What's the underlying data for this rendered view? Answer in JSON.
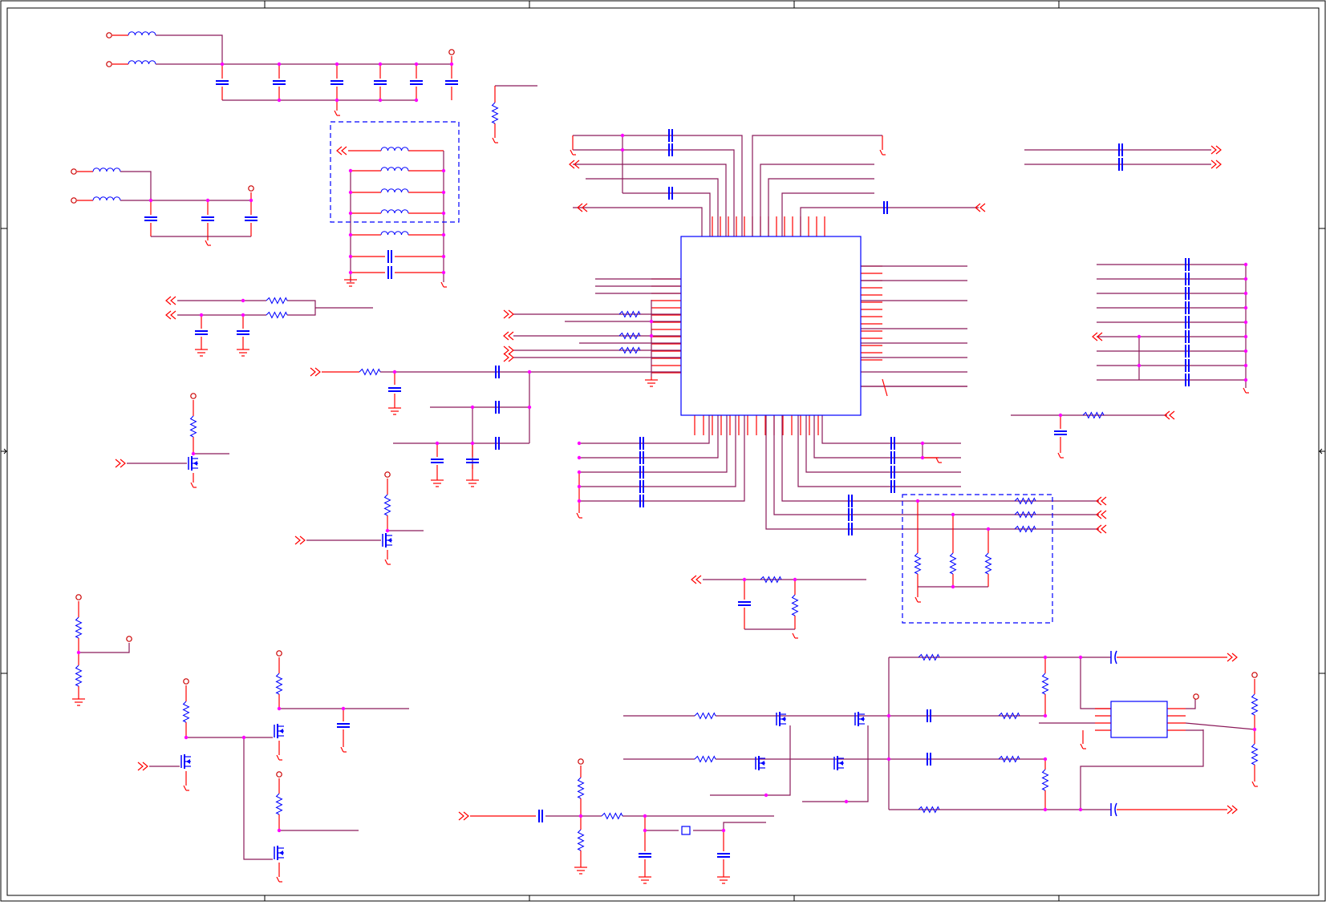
{
  "sheet": {
    "background": "#ffffff",
    "text_labels": []
  },
  "colors": {
    "frame": "#000000",
    "net_wire": "#8b1a5a",
    "component_stub": "#ff0000",
    "component_body": "#0000ff",
    "junction_dot": "#ff00ff",
    "power_flag": "#cc0000",
    "group_outline": "#0000ff"
  },
  "legend": {
    "wire": "net-wire",
    "component": "component",
    "junction": "junction"
  },
  "components": {
    "ic_main": {
      "kind": "ic-package",
      "pins_per_side": 12
    },
    "ic_small": {
      "kind": "ic-package",
      "pins_per_side": 4
    },
    "inductors": 12,
    "capacitors": 48,
    "resistors": 40,
    "mosfets": 10,
    "ground_symbols": 12,
    "power_flags": 14
  },
  "icons": {
    "inductor": "inductor-icon",
    "capacitor": "capacitor-icon",
    "resistor": "resistor-icon",
    "mosfet": "mosfet-icon",
    "ground": "ground-icon",
    "power": "power-flag-icon",
    "port_in": "input-port-icon",
    "port_out": "output-port-icon"
  }
}
